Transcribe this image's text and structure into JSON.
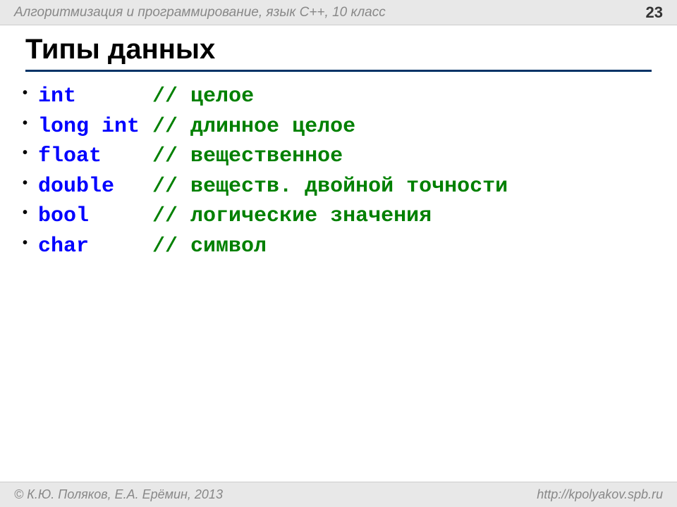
{
  "header": {
    "title": "Алгоритмизация и программирование, язык  C++, 10 класс",
    "page_number": "23"
  },
  "slide": {
    "title": "Типы данных"
  },
  "types": [
    {
      "keyword": "int     ",
      "comment": "// целое"
    },
    {
      "keyword": "long int",
      "comment": " // длинное целое"
    },
    {
      "keyword": "float   ",
      "comment": " // вещественное"
    },
    {
      "keyword": "double  ",
      "comment": " // веществ. двойной точности"
    },
    {
      "keyword": "bool    ",
      "comment": " // логические значения"
    },
    {
      "keyword": "char    ",
      "comment": " // символ"
    }
  ],
  "footer": {
    "left": "© К.Ю. Поляков, Е.А. Ерёмин, 2013",
    "right": "http://kpolyakov.spb.ru"
  }
}
